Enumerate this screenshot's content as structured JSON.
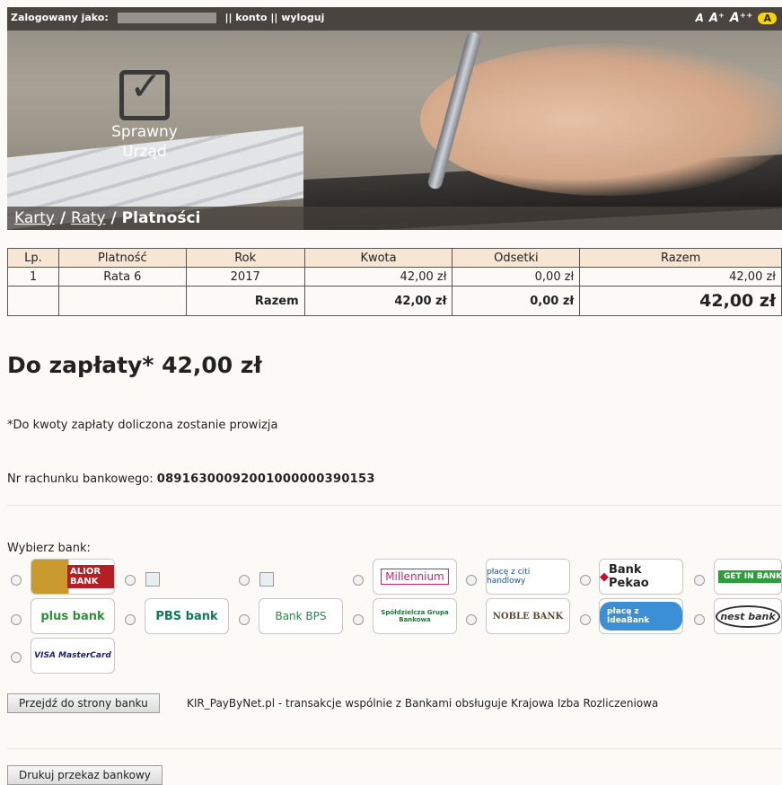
{
  "topbar": {
    "logged_as": "Zalogowany jako:",
    "links": "|| konto || wyloguj",
    "font_small": "A",
    "font_medium": "A⁺",
    "font_large": "A⁺⁺",
    "contrast": "A"
  },
  "logo": {
    "line1": "Sprawny",
    "line2": "Urząd"
  },
  "breadcrumb": {
    "item1": "Karty",
    "sep": " / ",
    "item2": "Raty",
    "current": "Platności"
  },
  "table": {
    "headers": [
      "Lp.",
      "Platność",
      "Rok",
      "Kwota",
      "Odsetki",
      "Razem"
    ],
    "rows": [
      [
        "1",
        "Rata 6",
        "2017",
        "42,00 zł",
        "0,00 zł",
        "42,00 zł"
      ]
    ],
    "summary": {
      "label": "Razem",
      "kwota": "42,00 zł",
      "odsetki": "0,00 zł",
      "razem": "42,00 zł"
    }
  },
  "due": {
    "label": "Do zapłaty* 42,00 zł"
  },
  "note": "*Do kwoty zapłaty doliczona zostanie prowizja",
  "account": {
    "label": "Nr rachunku bankowego:",
    "number": "08916300092001000000390153"
  },
  "banks": {
    "title": "Wybierz bank:",
    "items": [
      {
        "name": "ALIOR BANK",
        "color": "#b51f24"
      },
      {
        "name": "",
        "broken": true
      },
      {
        "name": "",
        "broken": true
      },
      {
        "name": "Millennium",
        "color": "#c8266b"
      },
      {
        "name": "płacę z citi handlowy",
        "color": "#1b4f91"
      },
      {
        "name": "Bank Pekao",
        "color": "#c8102e"
      },
      {
        "name": "GET IN BANK",
        "color": "#2e9e3c"
      },
      {
        "name": "plus bank",
        "color": "#2f8f3a"
      },
      {
        "name": "PBS bank",
        "color": "#0d7a55"
      },
      {
        "name": "Bank BPS",
        "color": "#1f8a4c"
      },
      {
        "name": "Spółdzielcza Grupa Bankowa",
        "color": "#1a7a3a"
      },
      {
        "name": "NOBLE BANK",
        "color": "#5b4a2f"
      },
      {
        "name": "płacę z IdeaBank",
        "color": "#3a8fd6"
      },
      {
        "name": "nest bank",
        "color": "#333333"
      },
      {
        "name": "VISA MasterCard",
        "color": "#1a1f71"
      }
    ]
  },
  "buttons": {
    "go_to_bank": "Przejdź do strony banku",
    "print_transfer": "Drukuj przekaz bankowy"
  },
  "kir_info": "KIR_PayByNet.pl - transakcje wspólnie z Bankami obsługuje Krajowa Izba Rozliczeniowa"
}
